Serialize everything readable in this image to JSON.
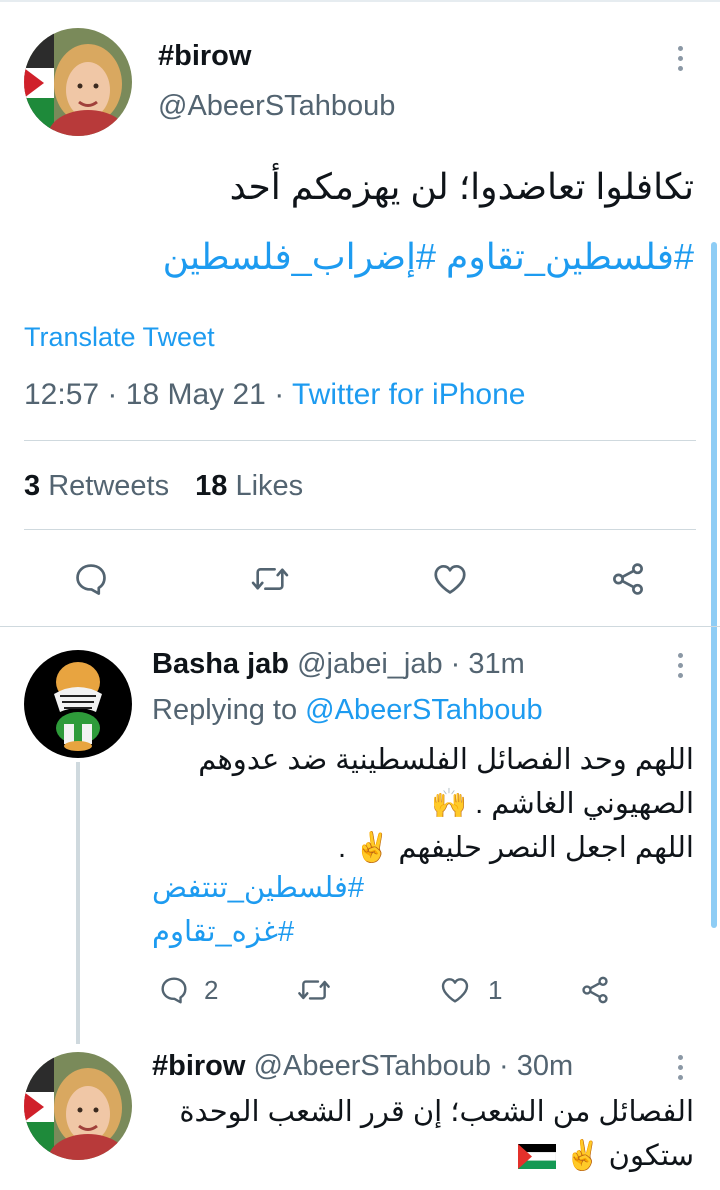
{
  "main_tweet": {
    "display_name": "#birow",
    "handle": "@AbeerSTahboub",
    "text": "تكافلوا تعاضدوا؛ لن يهزمكم أحد",
    "hashtags": "#فلسطين_تقاوم #إضراب_فلسطين",
    "translate_label": "Translate Tweet",
    "time": "12:57",
    "sep1": "·",
    "date": "18 May 21",
    "sep2": "·",
    "source": "Twitter for iPhone",
    "retweets_count": "3",
    "retweets_label": "Retweets",
    "likes_count": "18",
    "likes_label": "Likes"
  },
  "reply1": {
    "display_name": "Basha jab",
    "handle": "@jabei_jab",
    "sep": "·",
    "time": "31m",
    "replying_label": "Replying to",
    "replying_handle": "@AbeerSTahboub",
    "line1": "اللهم وحد الفصائل الفلسطينية ضد عدوهم",
    "line2": "الصهيوني الغاشم .",
    "line2_emoji": "🙌",
    "line3": "اللهم اجعل النصر حليفهم",
    "line3_emoji": "✌",
    "line3_end": ".",
    "hashtag1": "#فلسطين_تنتفض",
    "hashtag2": "#غزه_تقاوم",
    "reply_count": "2",
    "like_count": "1"
  },
  "reply2": {
    "display_name": "#birow",
    "handle": "@AbeerSTahboub",
    "sep": "·",
    "time": "30m",
    "line1": "الفصائل من الشعب؛ إن قرر الشعب الوحدة",
    "line2": "ستكون",
    "line2_emoji": "✌"
  },
  "colors": {
    "link": "#1d9bf0",
    "muted": "#536471",
    "divider": "#cfd9de",
    "scrollbar": "#8ecdf5"
  },
  "icons": [
    "more-icon",
    "reply-icon",
    "retweet-icon",
    "like-icon",
    "share-icon",
    "palestine-flag-icon"
  ]
}
